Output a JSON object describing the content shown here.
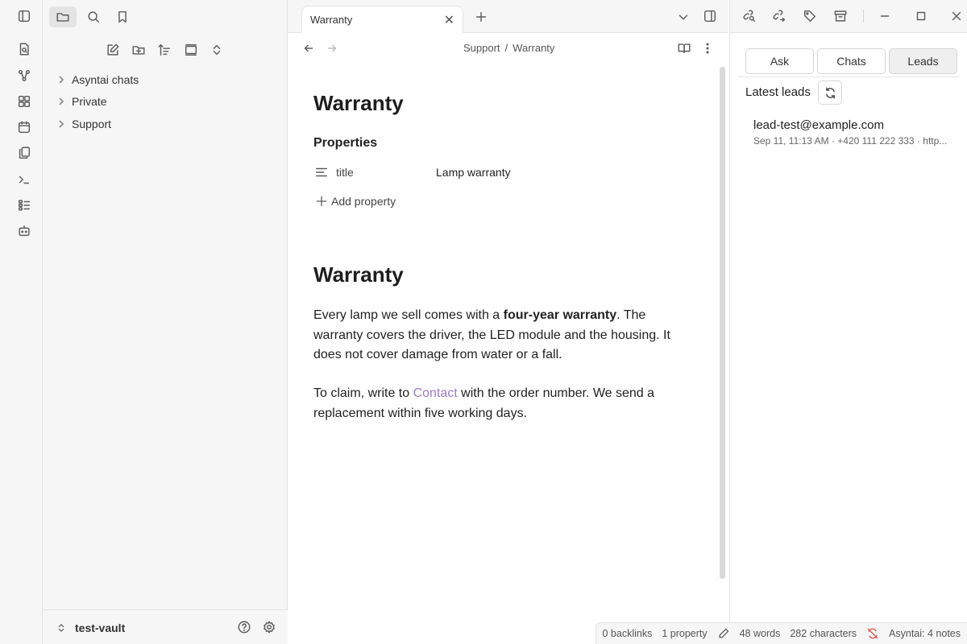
{
  "ribbon": {
    "icons": [
      "toggle-sidebar-icon",
      "open-quick-switcher-icon",
      "graph-view-icon",
      "canvas-icon",
      "daily-note-icon",
      "templates-icon",
      "command-palette-icon",
      "bases-icon",
      "asyntai-bot-icon"
    ]
  },
  "left_sidebar": {
    "tree": [
      {
        "label": "Asyntai chats"
      },
      {
        "label": "Private"
      },
      {
        "label": "Support"
      }
    ],
    "vault_name": "test-vault"
  },
  "tabs": [
    {
      "label": "Warranty"
    }
  ],
  "editor": {
    "breadcrumb_parent": "Support",
    "breadcrumb_sep": "/",
    "breadcrumb_current": "Warranty",
    "title": "Warranty",
    "properties_heading": "Properties",
    "property_key": "title",
    "property_value": "Lamp warranty",
    "add_property": "Add property",
    "heading": "Warranty",
    "p1_a": "Every lamp we sell comes with a ",
    "p1_bold": "four-year warranty",
    "p1_b": ". The warranty covers the driver, the LED module and the housing. It does not cover damage from water or a fall.",
    "p2_a": "To claim, write to ",
    "p2_link": "Contact",
    "p2_b": " with the order number. We send a replacement within five working days."
  },
  "right_panel": {
    "tabs": [
      {
        "label": "Ask",
        "active": false
      },
      {
        "label": "Chats",
        "active": false
      },
      {
        "label": "Leads",
        "active": true
      }
    ],
    "section_title": "Latest leads",
    "leads": [
      {
        "email": "lead-test@example.com",
        "meta": "Sep 11, 11:13 AM · +420 111 222 333 · http..."
      }
    ]
  },
  "status_bar": {
    "backlinks": "0 backlinks",
    "properties": "1 property",
    "words": "48 words",
    "characters": "282 characters",
    "plugin": "Asyntai: 4 notes"
  },
  "colors": {
    "link": "#9b7cc9",
    "plugin_icon": "#e04a4a"
  }
}
